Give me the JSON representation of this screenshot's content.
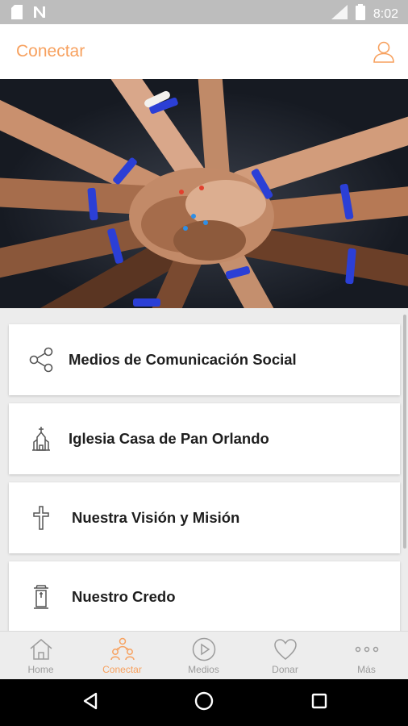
{
  "status_bar": {
    "time": "8:02",
    "icons": [
      "sd-card-icon",
      "notification-n-icon",
      "signal-icon",
      "battery-icon"
    ]
  },
  "header": {
    "title": "Conectar",
    "profile_icon": "person-outline-icon",
    "accent": "#f7a15f"
  },
  "list": {
    "items": [
      {
        "label": "Medios de Comunicación Social",
        "icon": "share-icon"
      },
      {
        "label": "Iglesia Casa de Pan Orlando",
        "icon": "church-icon"
      },
      {
        "label": "Nuestra Visión y Misión",
        "icon": "cross-icon"
      },
      {
        "label": "Nuestro Credo",
        "icon": "pulpit-icon"
      }
    ]
  },
  "bottom_nav": {
    "active": "Conectar",
    "items": [
      {
        "label": "Home",
        "icon": "home-icon"
      },
      {
        "label": "Conectar",
        "icon": "people-icon"
      },
      {
        "label": "Medios",
        "icon": "play-circle-icon"
      },
      {
        "label": "Donar",
        "icon": "heart-icon"
      },
      {
        "label": "Más",
        "icon": "more-dots-icon"
      }
    ]
  },
  "system_nav": {
    "buttons": [
      "back-triangle-icon",
      "home-circle-icon",
      "recents-square-icon"
    ]
  }
}
